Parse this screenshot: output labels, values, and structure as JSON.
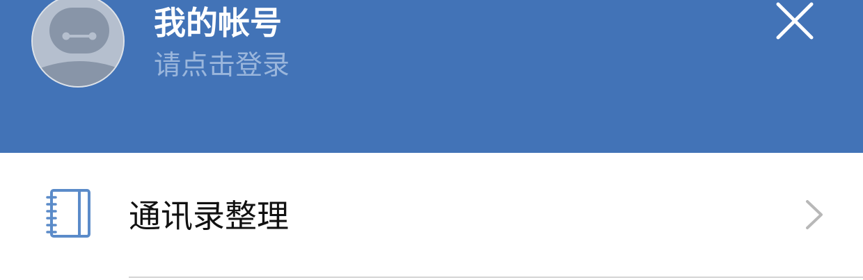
{
  "header": {
    "title": "我的帐号",
    "subtitle": "请点击登录",
    "background_color": "#4273b7",
    "avatar_icon": "robot-avatar-icon",
    "close_icon": "close-icon"
  },
  "menu": {
    "items": [
      {
        "label": "通讯录整理",
        "icon": "address-book-icon",
        "icon_color": "#5b8bc9",
        "trailing_icon": "chevron-right-icon"
      }
    ]
  }
}
